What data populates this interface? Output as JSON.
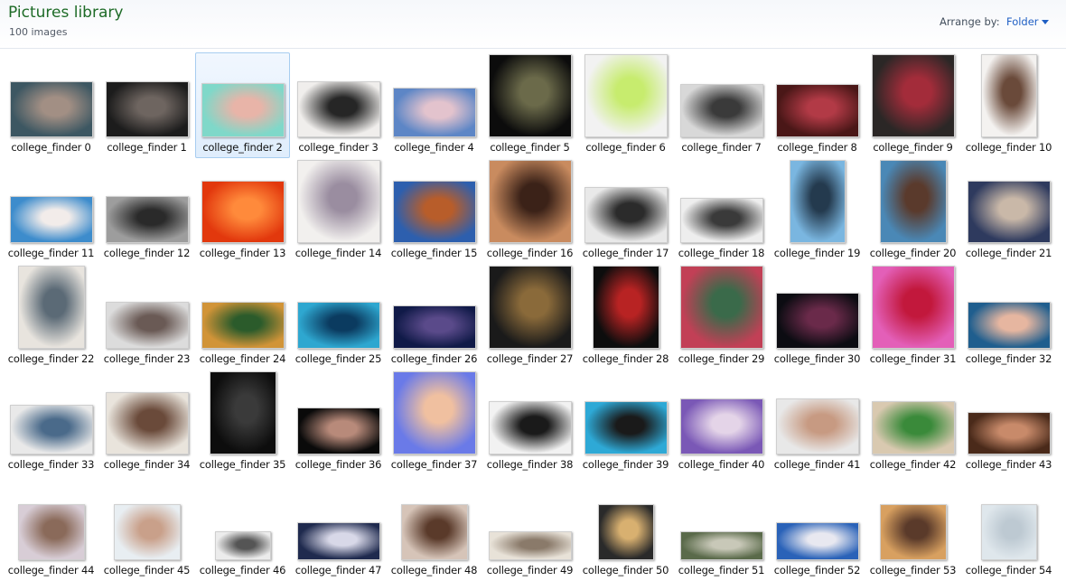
{
  "header": {
    "title": "Pictures library",
    "count": "100 images",
    "arrange_label": "Arrange by:",
    "arrange_value": "Folder"
  },
  "selected_index": 2,
  "images": [
    {
      "label": "college_finder 0",
      "w": 90,
      "h": 60,
      "c1": "#3d5762",
      "c2": "#a28f84"
    },
    {
      "label": "college_finder 1",
      "w": 90,
      "h": 60,
      "c1": "#1c1c1c",
      "c2": "#6e6560"
    },
    {
      "label": "college_finder 2",
      "w": 90,
      "h": 58,
      "c1": "#7fd8c9",
      "c2": "#e8b4a8"
    },
    {
      "label": "college_finder 3",
      "w": 90,
      "h": 60,
      "c1": "#f0eeec",
      "c2": "#262626"
    },
    {
      "label": "college_finder 4",
      "w": 90,
      "h": 53,
      "c1": "#5d86c6",
      "c2": "#e3c3cd"
    },
    {
      "label": "college_finder 5",
      "w": 90,
      "h": 90,
      "c1": "#0c0c0c",
      "c2": "#6b6a4a"
    },
    {
      "label": "college_finder 6",
      "w": 90,
      "h": 90,
      "c1": "#f2f2f2",
      "c2": "#c7ec6e"
    },
    {
      "label": "college_finder 7",
      "w": 90,
      "h": 57,
      "c1": "#d8d8d8",
      "c2": "#3a3a3a"
    },
    {
      "label": "college_finder 8",
      "w": 90,
      "h": 57,
      "c1": "#4a1717",
      "c2": "#b23a46"
    },
    {
      "label": "college_finder 9",
      "w": 90,
      "h": 90,
      "c1": "#2b2726",
      "c2": "#a32c3a"
    },
    {
      "label": "college_finder 10",
      "w": 60,
      "h": 90,
      "c1": "#f4f2f0",
      "c2": "#6a4a3a"
    },
    {
      "label": "college_finder 11",
      "w": 90,
      "h": 50,
      "c1": "#3d8ccc",
      "c2": "#f2ecea"
    },
    {
      "label": "college_finder 12",
      "w": 90,
      "h": 50,
      "c1": "#9d9d9d",
      "c2": "#2a2a2a"
    },
    {
      "label": "college_finder 13",
      "w": 90,
      "h": 67,
      "c1": "#e2380d",
      "c2": "#ff8a3b"
    },
    {
      "label": "college_finder 14",
      "w": 90,
      "h": 90,
      "c1": "#f2f0ee",
      "c2": "#9a8da0"
    },
    {
      "label": "college_finder 15",
      "w": 90,
      "h": 67,
      "c1": "#2d5fae",
      "c2": "#b85d2a"
    },
    {
      "label": "college_finder 16",
      "w": 90,
      "h": 90,
      "c1": "#c98b5f",
      "c2": "#3b2218"
    },
    {
      "label": "college_finder 17",
      "w": 90,
      "h": 60,
      "c1": "#e9e9e9",
      "c2": "#2b2b2b"
    },
    {
      "label": "college_finder 18",
      "w": 90,
      "h": 48,
      "c1": "#eeeeee",
      "c2": "#3a3a3a"
    },
    {
      "label": "college_finder 19",
      "w": 60,
      "h": 90,
      "c1": "#7ab6e0",
      "c2": "#243a4e"
    },
    {
      "label": "college_finder 20",
      "w": 72,
      "h": 90,
      "c1": "#4a88b6",
      "c2": "#5a3a2c"
    },
    {
      "label": "college_finder 21",
      "w": 90,
      "h": 67,
      "c1": "#2e3a5e",
      "c2": "#c9b8a8"
    },
    {
      "label": "college_finder 22",
      "w": 72,
      "h": 90,
      "c1": "#e8e4de",
      "c2": "#5b6a76"
    },
    {
      "label": "college_finder 23",
      "w": 90,
      "h": 50,
      "c1": "#dcdcdc",
      "c2": "#6a5a55"
    },
    {
      "label": "college_finder 24",
      "w": 90,
      "h": 50,
      "c1": "#d19438",
      "c2": "#2b5b2b"
    },
    {
      "label": "college_finder 25",
      "w": 90,
      "h": 50,
      "c1": "#2ea7d0",
      "c2": "#0b3b60"
    },
    {
      "label": "college_finder 26",
      "w": 90,
      "h": 46,
      "c1": "#101a48",
      "c2": "#5a4a8a"
    },
    {
      "label": "college_finder 27",
      "w": 90,
      "h": 90,
      "c1": "#1a1a1a",
      "c2": "#8a6a3a"
    },
    {
      "label": "college_finder 28",
      "w": 72,
      "h": 90,
      "c1": "#0d0d0d",
      "c2": "#b82323"
    },
    {
      "label": "college_finder 29",
      "w": 90,
      "h": 90,
      "c1": "#c24056",
      "c2": "#3a6a4a"
    },
    {
      "label": "college_finder 30",
      "w": 90,
      "h": 60,
      "c1": "#0c0c12",
      "c2": "#6a2a4a"
    },
    {
      "label": "college_finder 31",
      "w": 90,
      "h": 90,
      "c1": "#e35fb8",
      "c2": "#c2183c"
    },
    {
      "label": "college_finder 32",
      "w": 90,
      "h": 50,
      "c1": "#1f5e8e",
      "c2": "#e6b6a0"
    },
    {
      "label": "college_finder 33",
      "w": 90,
      "h": 53,
      "c1": "#e9e9e9",
      "c2": "#4a6a8a"
    },
    {
      "label": "college_finder 34",
      "w": 90,
      "h": 67,
      "c1": "#e9e4dc",
      "c2": "#6a4a3a"
    },
    {
      "label": "college_finder 35",
      "w": 72,
      "h": 90,
      "c1": "#0d0d0d",
      "c2": "#3a3a3a"
    },
    {
      "label": "college_finder 36",
      "w": 90,
      "h": 50,
      "c1": "#0a0a0a",
      "c2": "#b88a7a"
    },
    {
      "label": "college_finder 37",
      "w": 90,
      "h": 90,
      "c1": "#6a7ae8",
      "c2": "#f0c0a0"
    },
    {
      "label": "college_finder 38",
      "w": 90,
      "h": 57,
      "c1": "#f2f2f2",
      "c2": "#1a1a1a"
    },
    {
      "label": "college_finder 39",
      "w": 90,
      "h": 57,
      "c1": "#2ea9d6",
      "c2": "#1a1a1a"
    },
    {
      "label": "college_finder 40",
      "w": 90,
      "h": 60,
      "c1": "#7a58b6",
      "c2": "#e4d4e8"
    },
    {
      "label": "college_finder 41",
      "w": 90,
      "h": 60,
      "c1": "#e8e8e8",
      "c2": "#c79a82"
    },
    {
      "label": "college_finder 42",
      "w": 90,
      "h": 57,
      "c1": "#d9c9b0",
      "c2": "#3a8a3a"
    },
    {
      "label": "college_finder 43",
      "w": 90,
      "h": 45,
      "c1": "#4a2a1a",
      "c2": "#c88a6a"
    },
    {
      "label": "college_finder 44",
      "w": 72,
      "h": 60,
      "c1": "#d8cdd6",
      "c2": "#8a6a5a"
    },
    {
      "label": "college_finder 45",
      "w": 72,
      "h": 60,
      "c1": "#e8eef2",
      "c2": "#c9a08a"
    },
    {
      "label": "college_finder 46",
      "w": 60,
      "h": 30,
      "c1": "#ececec",
      "c2": "#555555"
    },
    {
      "label": "college_finder 47",
      "w": 90,
      "h": 40,
      "c1": "#1f2a4e",
      "c2": "#d8d8e8"
    },
    {
      "label": "college_finder 48",
      "w": 72,
      "h": 60,
      "c1": "#d6c4b8",
      "c2": "#5a3a2a"
    },
    {
      "label": "college_finder 49",
      "w": 90,
      "h": 30,
      "c1": "#e8e2d8",
      "c2": "#8a7a6a"
    },
    {
      "label": "college_finder 50",
      "w": 60,
      "h": 60,
      "c1": "#2a2a2a",
      "c2": "#d8b070"
    },
    {
      "label": "college_finder 51",
      "w": 90,
      "h": 30,
      "c1": "#5a6a4a",
      "c2": "#c8c8b8"
    },
    {
      "label": "college_finder 52",
      "w": 90,
      "h": 40,
      "c1": "#2a62b8",
      "c2": "#e8e8f0"
    },
    {
      "label": "college_finder 53",
      "w": 72,
      "h": 60,
      "c1": "#d8a060",
      "c2": "#5a3a2a"
    },
    {
      "label": "college_finder 54",
      "w": 60,
      "h": 60,
      "c1": "#dfe7ec",
      "c2": "#bdc9d2"
    }
  ]
}
